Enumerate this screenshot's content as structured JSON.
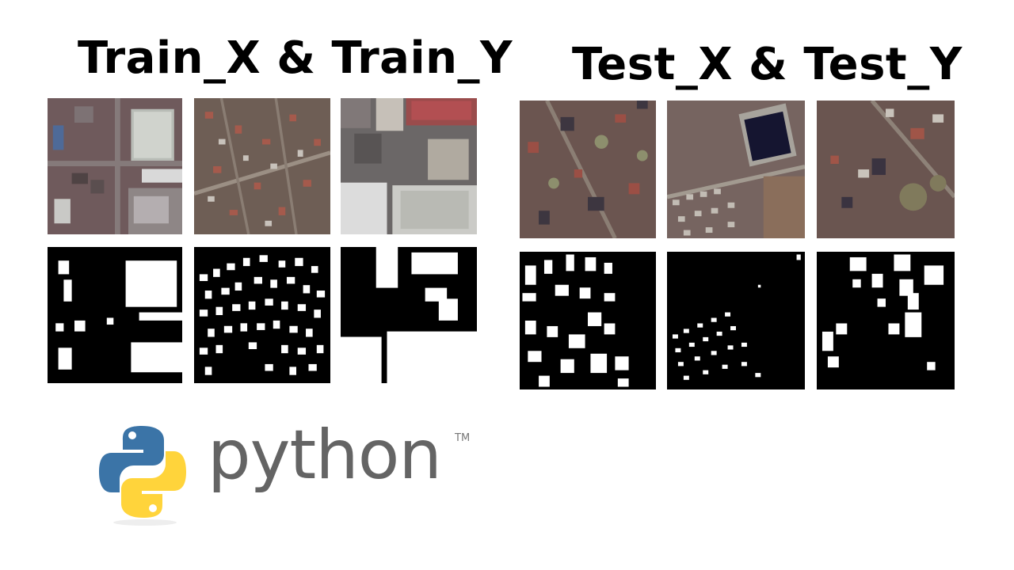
{
  "headings": {
    "train": "Train_X & Train_Y",
    "test": "Test_X & Test_Y"
  },
  "logo": {
    "wordmark": "python",
    "trademark": "TM",
    "icon": "python-logo-icon",
    "colors": {
      "blue": "#3b74a7",
      "yellow": "#ffd43b",
      "text": "#646464"
    }
  },
  "panels": {
    "train": {
      "images": [
        "satellite-image",
        "satellite-image",
        "satellite-image"
      ],
      "masks": [
        "building-mask",
        "building-mask",
        "building-mask"
      ]
    },
    "test": {
      "images": [
        "satellite-image",
        "satellite-image",
        "satellite-image"
      ],
      "masks": [
        "building-mask",
        "building-mask",
        "building-mask"
      ]
    }
  }
}
